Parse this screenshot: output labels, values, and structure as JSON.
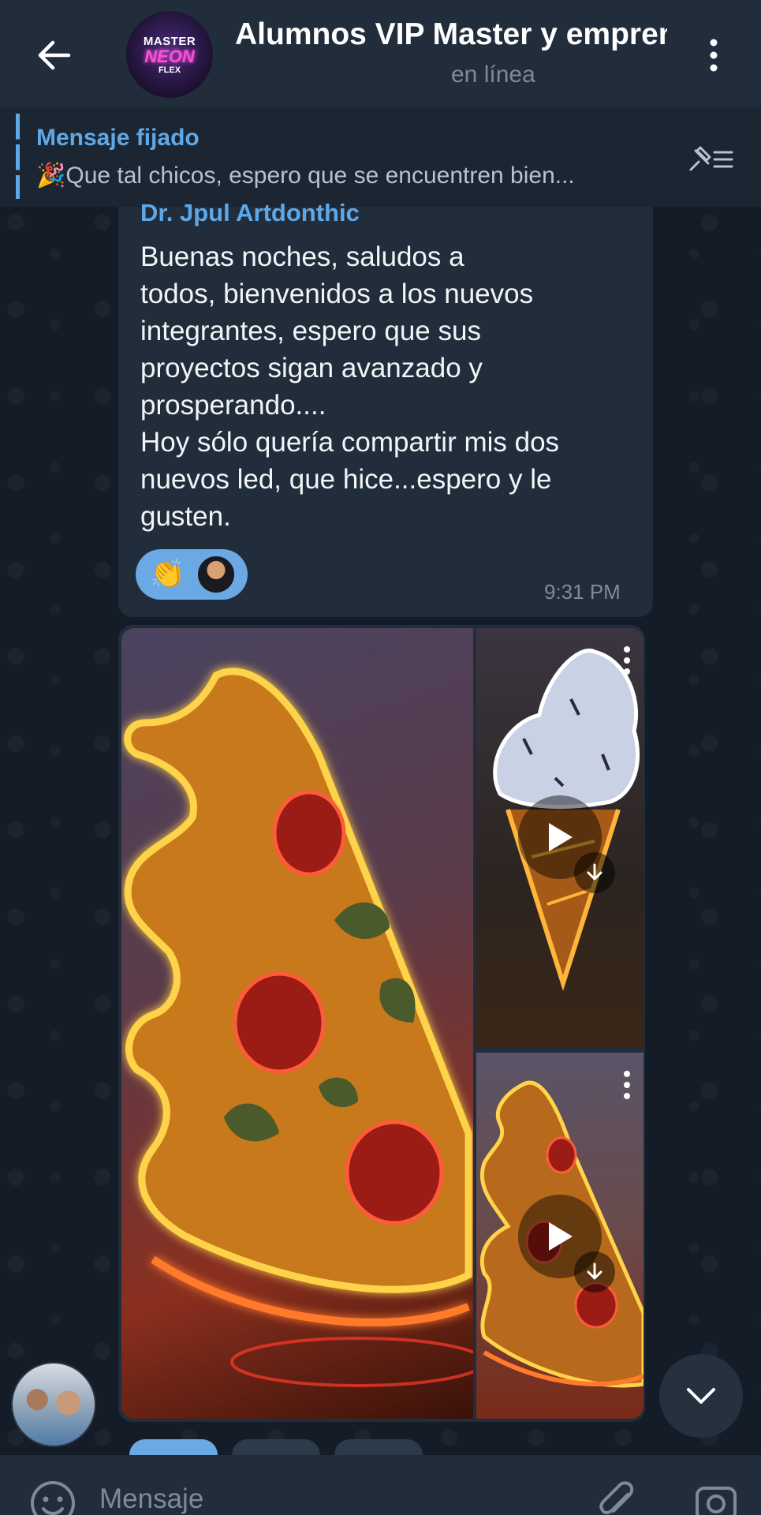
{
  "header": {
    "back_icon": "arrow-left-icon",
    "avatar_lines": [
      "MASTER",
      "NEON",
      "FLEX"
    ],
    "title": "Alumnos VIP Master y emprendedores",
    "status": "en línea",
    "menu_icon": "more-vertical-icon"
  },
  "pinned": {
    "title": "Mensaje fijado",
    "emoji": "🎉",
    "text": "Que tal chicos, espero que se encuentren bien...",
    "list_icon": "pinned-list-icon"
  },
  "message": {
    "sender": "Dr. Jpul Artdonthic",
    "text": "Buenas noches, saludos a\ntodos, bienvenidos a los nuevos\nintegrantes, espero que sus\nproyectos sigan avanzado y\nprosperando....\nHoy sólo quería compartir mis dos\nnuevos led, que hice...espero y le\ngusten.",
    "reaction_emoji": "👏",
    "time": "9:31 PM"
  },
  "media": {
    "items": [
      {
        "type": "photo",
        "subject": "neon pizza slice"
      },
      {
        "type": "video",
        "subject": "neon ice cream cone"
      },
      {
        "type": "video",
        "subject": "neon pizza slice"
      }
    ]
  },
  "composer": {
    "placeholder": "Mensaje",
    "emoji_icon": "smile-icon",
    "attach_icon": "paperclip-icon",
    "camera_icon": "camera-icon"
  },
  "colors": {
    "accent": "#5fa8e8",
    "header_bg": "#212d3b",
    "bubble_bg": "#212d3b",
    "chat_bg": "#141d27"
  }
}
